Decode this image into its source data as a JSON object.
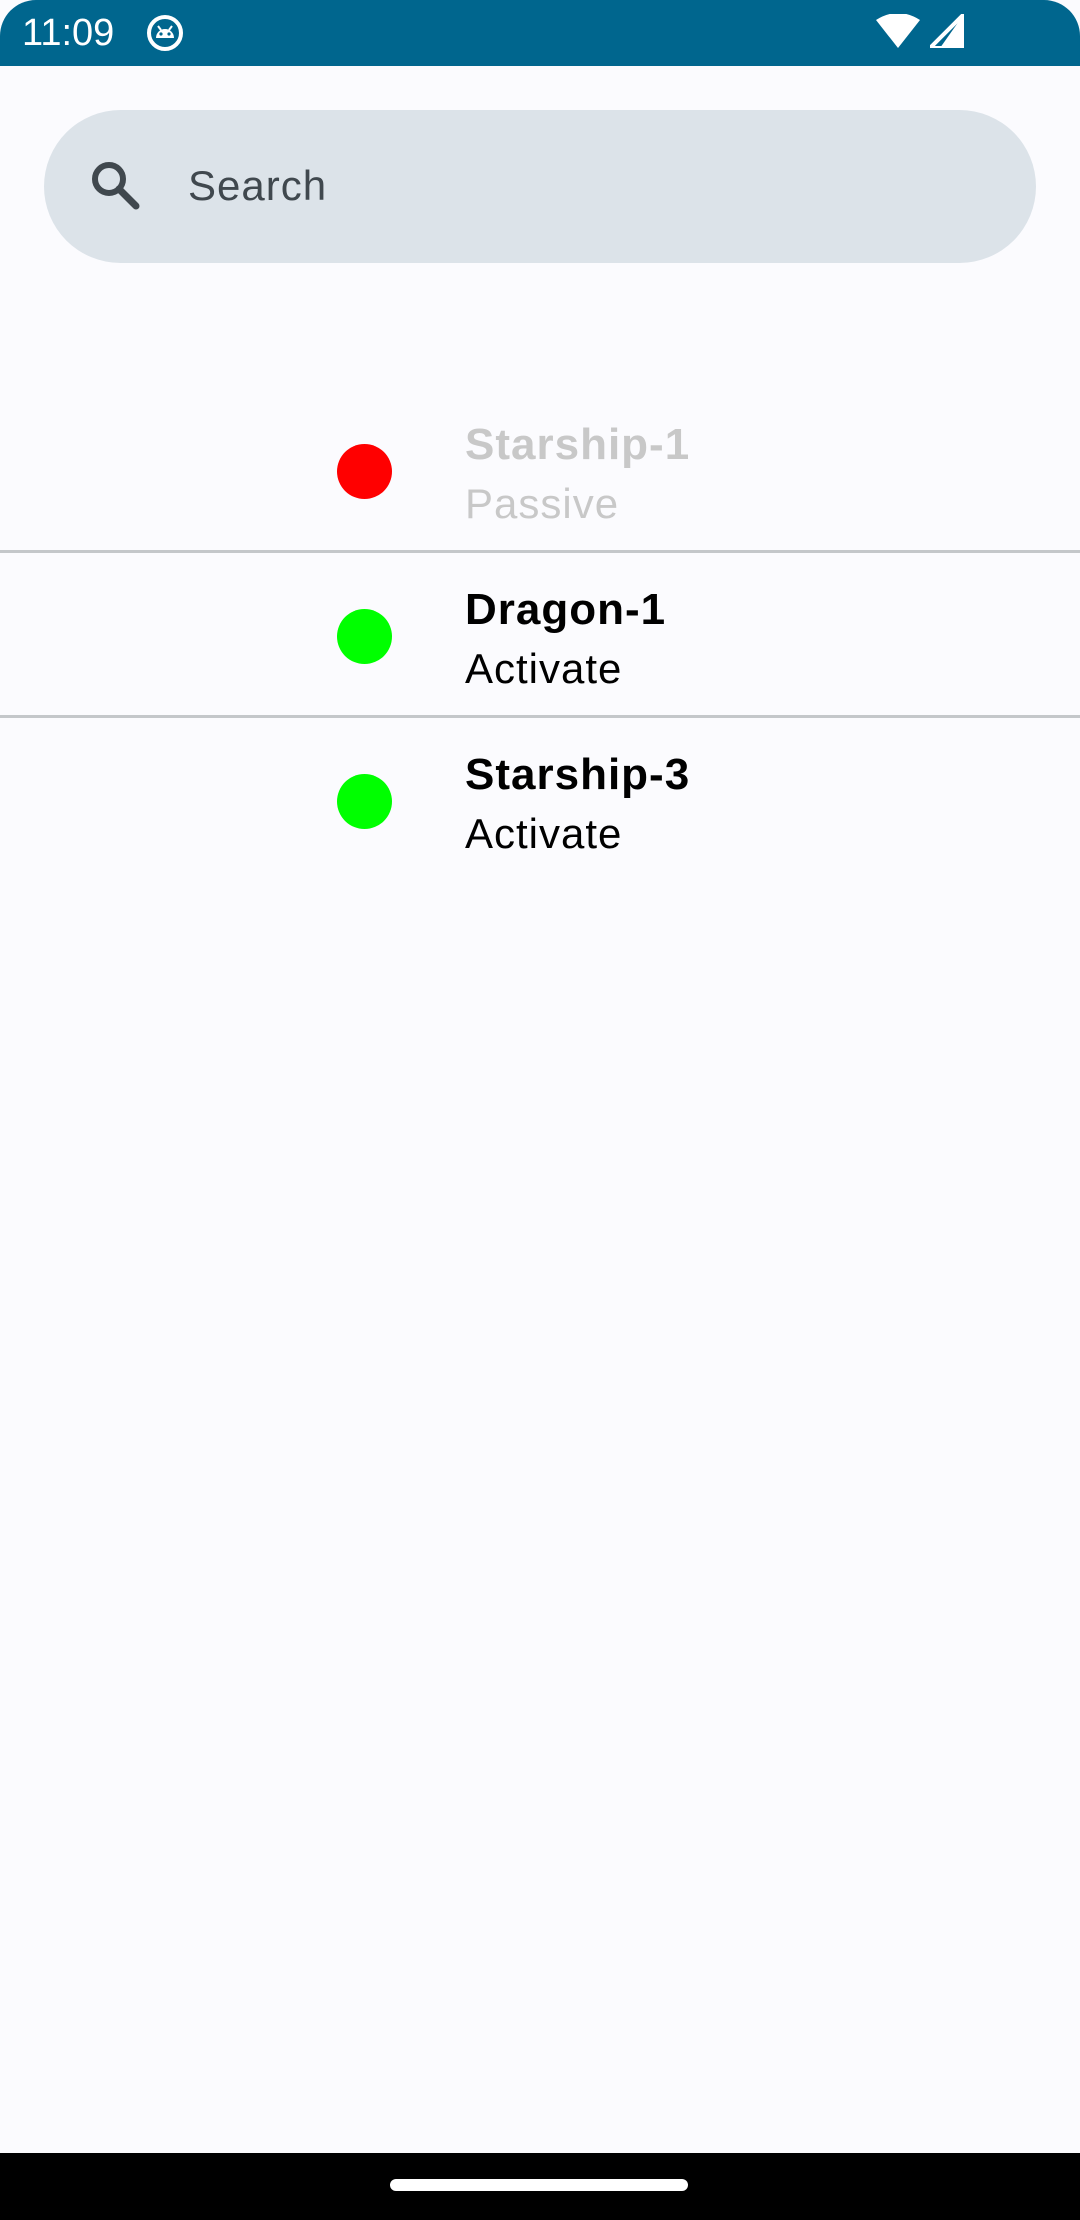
{
  "status_bar": {
    "time": "11:09",
    "app_icon": "android-robot-icon",
    "wifi_icon": "wifi-icon",
    "signal_icon": "cell-signal-icon",
    "color": "#00668e"
  },
  "search": {
    "placeholder": "Search",
    "icon": "search-icon"
  },
  "list": {
    "items": [
      {
        "name": "Starship-1",
        "state": "Passive",
        "indicator_color": "#ff0000",
        "dimmed": true
      },
      {
        "name": "Dragon-1",
        "state": "Activate",
        "indicator_color": "#00ff00",
        "dimmed": false
      },
      {
        "name": "Starship-3",
        "state": "Activate",
        "indicator_color": "#00ff00",
        "dimmed": false
      }
    ]
  },
  "nav_bar": {
    "home_handle": "home-gesture-handle"
  }
}
